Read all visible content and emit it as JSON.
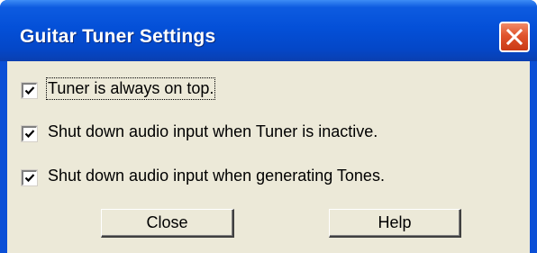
{
  "window": {
    "title": "Guitar Tuner Settings",
    "title_bar_color": "#0450d8",
    "close_icon": "close-x-icon"
  },
  "options": [
    {
      "label": "Tuner is always on top.",
      "checked": true
    },
    {
      "label": "Shut down audio input when Tuner is inactive.",
      "checked": true
    },
    {
      "label": "Shut down audio input when generating Tones.",
      "checked": true
    }
  ],
  "buttons": {
    "close_label": "Close",
    "help_label": "Help"
  }
}
